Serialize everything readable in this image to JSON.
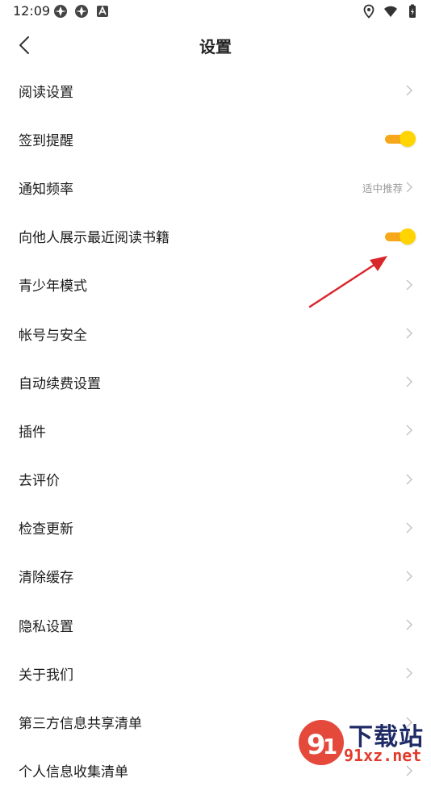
{
  "status_bar": {
    "time": "12:09",
    "left_icons": [
      "app-notification-icon",
      "app-notification-icon",
      "android-notification-icon"
    ],
    "right_icons": [
      "location-icon",
      "wifi-icon",
      "battery-icon"
    ]
  },
  "header": {
    "title": "设置",
    "back_icon": "chevron-left-icon"
  },
  "colors": {
    "toggle_track": "#f6a81a",
    "toggle_knob": "#ffd400",
    "annotation_arrow": "#d9262b"
  },
  "settings": [
    {
      "label": "阅读设置",
      "control": "chevron"
    },
    {
      "label": "签到提醒",
      "control": "toggle",
      "on": true
    },
    {
      "label": "通知频率",
      "control": "chevron",
      "value": "适中推荐"
    },
    {
      "label": "向他人展示最近阅读书籍",
      "control": "toggle",
      "on": true
    },
    {
      "label": "青少年模式",
      "control": "chevron"
    },
    {
      "label": "帐号与安全",
      "control": "chevron"
    },
    {
      "label": "自动续费设置",
      "control": "chevron"
    },
    {
      "label": "插件",
      "control": "chevron"
    },
    {
      "label": "去评价",
      "control": "chevron"
    },
    {
      "label": "检查更新",
      "control": "chevron"
    },
    {
      "label": "清除缓存",
      "control": "chevron"
    },
    {
      "label": "隐私设置",
      "control": "chevron"
    },
    {
      "label": "关于我们",
      "control": "chevron"
    },
    {
      "label": "第三方信息共享清单",
      "control": "chevron"
    },
    {
      "label": "个人信息收集清单",
      "control": "chevron"
    }
  ],
  "watermark": {
    "top_text": "下载站",
    "bottom_text": "91xz.net"
  }
}
